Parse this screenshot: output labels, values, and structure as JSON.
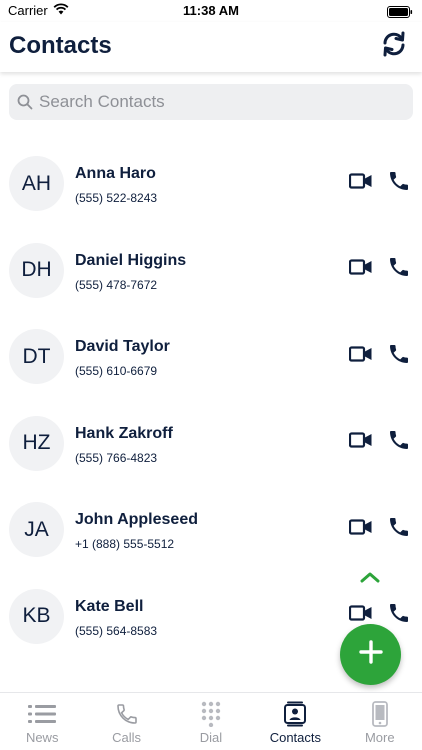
{
  "status_bar": {
    "carrier": "Carrier",
    "time": "11:38 AM"
  },
  "header": {
    "title": "Contacts",
    "sync_icon": "sync-icon"
  },
  "search": {
    "placeholder": "Search Contacts",
    "value": ""
  },
  "contacts": [
    {
      "initials": "AH",
      "name": "Anna Haro",
      "phone": "(555) 522-8243"
    },
    {
      "initials": "DH",
      "name": "Daniel Higgins",
      "phone": "(555) 478-7672"
    },
    {
      "initials": "DT",
      "name": "David Taylor",
      "phone": "(555) 610-6679"
    },
    {
      "initials": "HZ",
      "name": "Hank Zakroff",
      "phone": "(555) 766-4823"
    },
    {
      "initials": "JA",
      "name": "John Appleseed",
      "phone": "+1 (888) 555-5512"
    },
    {
      "initials": "KB",
      "name": "Kate Bell",
      "phone": "(555) 564-8583"
    }
  ],
  "tabbar": {
    "tabs": [
      {
        "label": "News",
        "icon": "news-icon"
      },
      {
        "label": "Calls",
        "icon": "phone-icon"
      },
      {
        "label": "Dial",
        "icon": "dialpad-icon"
      },
      {
        "label": "Contacts",
        "icon": "contacts-icon"
      },
      {
        "label": "More",
        "icon": "device-icon"
      }
    ],
    "active": "Contacts"
  },
  "colors": {
    "primary": "#0f1f3d",
    "accent_green": "#2da43a",
    "inactive": "#9a9ca2",
    "avatar_bg": "#f1f2f4"
  }
}
